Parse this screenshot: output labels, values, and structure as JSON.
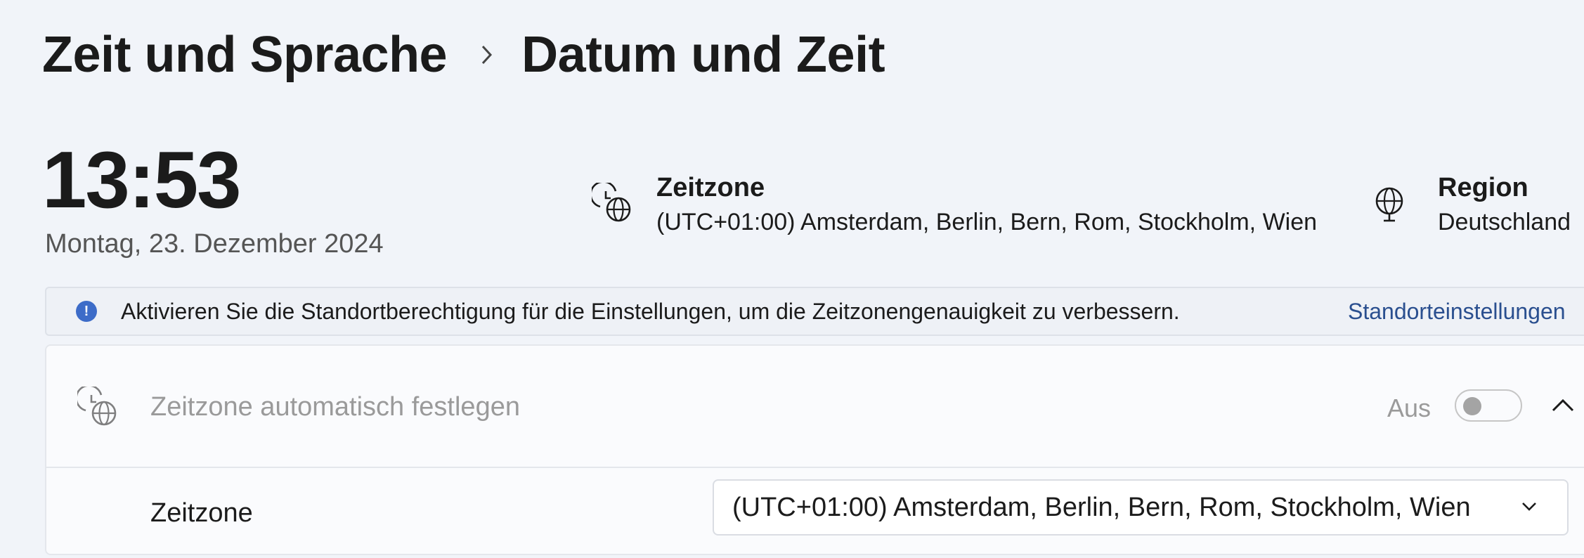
{
  "breadcrumb": {
    "parent": "Zeit und Sprache",
    "current": "Datum und Zeit"
  },
  "clock": {
    "time": "13:53",
    "date": "Montag, 23. Dezember 2024"
  },
  "timezone_info": {
    "title": "Zeitzone",
    "value": "(UTC+01:00) Amsterdam, Berlin, Bern, Rom, Stockholm, Wien",
    "icon": "clock-globe-icon"
  },
  "region_info": {
    "title": "Region",
    "value": "Deutschland",
    "icon": "globe-icon"
  },
  "banner": {
    "text": "Aktivieren Sie die Standortberechtigung für die Einstellungen, um die Zeitzonengenauigkeit zu verbessern.",
    "link": "Standorteinstellungen",
    "icon": "info-icon",
    "icon_glyph": "!",
    "accent": "#3d6cc8"
  },
  "auto_timezone": {
    "label": "Zeitzone automatisch festlegen",
    "state_label": "Aus",
    "enabled": false,
    "icon": "clock-globe-icon"
  },
  "timezone_setting": {
    "label": "Zeitzone",
    "selected": "(UTC+01:00) Amsterdam, Berlin, Bern, Rom, Stockholm, Wien"
  }
}
